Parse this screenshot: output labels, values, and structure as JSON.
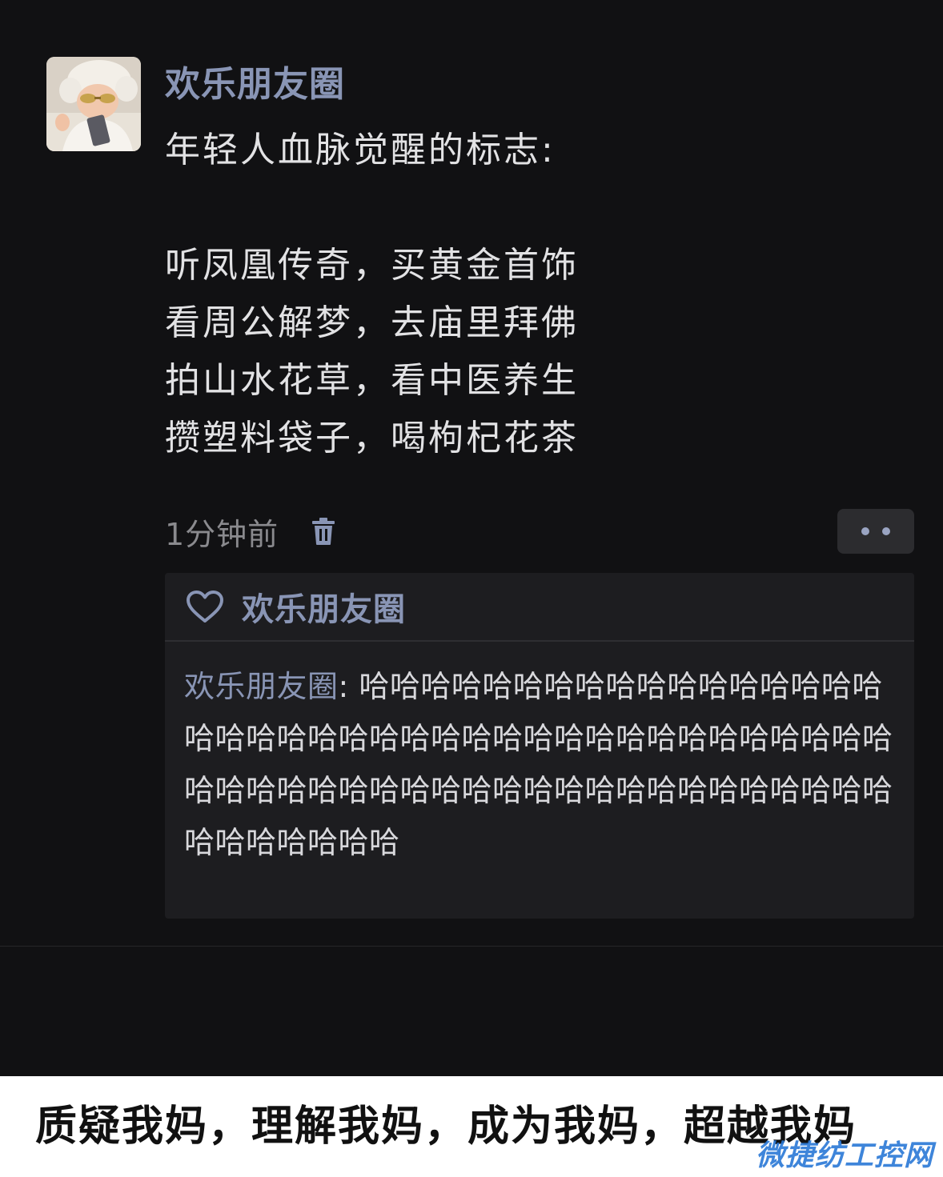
{
  "post": {
    "author_name": "欢乐朋友圈",
    "lines": [
      "年轻人血脉觉醒的标志:",
      "",
      "听凤凰传奇，买黄金首饰",
      "看周公解梦，去庙里拜佛",
      "拍山水花草，看中医养生",
      "攒塑料袋子，喝枸杞花茶"
    ],
    "timestamp": "1分钟前",
    "delete_icon": "trash-icon",
    "more_icon": "more-dots-icon"
  },
  "interactions": {
    "like_icon": "heart-icon",
    "liked_by": "欢乐朋友圈",
    "comment": {
      "author": "欢乐朋友圈",
      "separator": ": ",
      "text": "哈哈哈哈哈哈哈哈哈哈哈哈哈哈哈哈哈哈哈哈哈哈哈哈哈哈哈哈哈哈哈哈哈哈哈哈哈哈哈哈哈哈哈哈哈哈哈哈哈哈哈哈哈哈哈哈哈哈哈哈哈哈哈哈哈哈哈哈哈哈"
    }
  },
  "caption": "质疑我妈，理解我妈，成为我妈，超越我妈",
  "watermark": "微捷纺工控网",
  "colors": {
    "background": "#111113",
    "name": "#8995b5",
    "body_text": "#e2e2e4",
    "panel": "#1d1d20",
    "watermark": "#2a78d6"
  }
}
